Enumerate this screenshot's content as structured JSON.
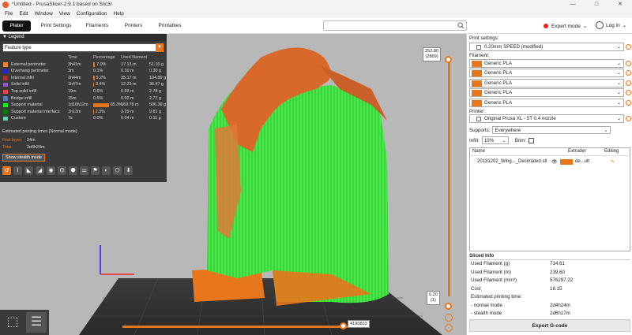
{
  "window": {
    "title": "*Untitled - PrusaSlicer-2.9.1 based on Slic3r",
    "controls": [
      "—",
      "□",
      "✕"
    ]
  },
  "menu": [
    "File",
    "Edit",
    "Window",
    "View",
    "Configuration",
    "Help"
  ],
  "tabs": [
    "Plater",
    "Print Settings",
    "Filaments",
    "Printers",
    "Printables"
  ],
  "search": {
    "placeholder": ""
  },
  "mode": {
    "label": "Expert mode",
    "color": "#e22222"
  },
  "login": {
    "label": "Log in"
  },
  "legend": {
    "header": "Legend",
    "view_type": "Feature type",
    "columns": [
      "Time",
      "Percentage",
      "Used filament"
    ],
    "rows": [
      {
        "name": "External perimeter",
        "time": "3h41m",
        "pct": "7.0%",
        "pct_value": 0.07,
        "length": "17.13 m",
        "weight": "51.10 g",
        "color": "#ff7f2a"
      },
      {
        "name": "Overhang perimeter",
        "time": "3m",
        "pct": "0.1%",
        "pct_value": 0.001,
        "length": "0.10 m",
        "weight": "0.30 g",
        "color": "#1f1fff"
      },
      {
        "name": "Internal infill",
        "time": "2h44m",
        "pct": "5.2%",
        "pct_value": 0.052,
        "length": "35.17 m",
        "weight": "104.89 g",
        "color": "#b03029"
      },
      {
        "name": "Solid infill",
        "time": "1h47m",
        "pct": "3.4%",
        "pct_value": 0.034,
        "length": "12.23 m",
        "weight": "36.47 g",
        "color": "#9654cc"
      },
      {
        "name": "Top solid infill",
        "time": "19m",
        "pct": "0.6%",
        "pct_value": 0.006,
        "length": "0.93 m",
        "weight": "2.78 g",
        "color": "#f04040"
      },
      {
        "name": "Bridge infill",
        "time": "15m",
        "pct": "0.5%",
        "pct_value": 0.005,
        "length": "0.93 m",
        "weight": "2.77 g",
        "color": "#4d80ba"
      },
      {
        "name": "Support material",
        "time": "1d10h12m",
        "pct": "65.3%",
        "pct_value": 0.653,
        "length": "169.78 m",
        "weight": "506.39 g",
        "color": "#00ff00"
      },
      {
        "name": "Support material interface",
        "time": "1h13m",
        "pct": "2.3%",
        "pct_value": 0.023,
        "length": "3.29 m",
        "weight": "9.81 g",
        "color": "#008000"
      },
      {
        "name": "Custom",
        "time": "7s",
        "pct": "0.0%",
        "pct_value": 0.0,
        "length": "0.04 m",
        "weight": "0.11 g",
        "color": "#5ed3b0"
      }
    ],
    "est_title": "Estimated printing times [Normal mode]:",
    "first_layer_label": "First layer:",
    "first_layer_value": "24m",
    "total_label": "Total:",
    "total_value": "2d4h24m",
    "stealth_button": "Show stealth mode"
  },
  "sliders": {
    "vertical_top": "252.80",
    "vertical_top_sub": "(2869)",
    "vertical_bottom": "0.20",
    "vertical_bottom_sub": "(1)",
    "horizontal": "4190833"
  },
  "right_panel": {
    "print_settings_label": "Print settings:",
    "print_profile": "0.20mm SPEED (modified)",
    "filament_label": "Filament:",
    "filaments": [
      "Generic PLA",
      "Generic PLA",
      "Generic PLA",
      "Generic PLA",
      "Generic PLA"
    ],
    "filament_colors": [
      "#e8761c",
      "#e8761c",
      "#e8761c",
      "#e8761c",
      "#e8761c"
    ],
    "printer_label": "Printer:",
    "printer": "Original Prusa XL - 5T 0.4 nozzle",
    "supports_label": "Supports:",
    "supports_value": "Everywhere",
    "infill_label": "Infill:",
    "infill_value": "10%",
    "brim_label": "Brim:",
    "object_columns": [
      "Name",
      "Extruder",
      "Editing"
    ],
    "object_name": "20131202_Wing..._Decimated.stl",
    "object_extruder": "de...ult",
    "sliced_title": "Sliced Info",
    "sliced_rows": [
      {
        "k": "Used Filament (g)",
        "v": "714.61"
      },
      {
        "k": "Used Filament (m)",
        "v": "239.60"
      },
      {
        "k": "Used Filament (mm³)",
        "v": "576297.22"
      },
      {
        "k": "Cost",
        "v": "18.15"
      },
      {
        "k": "Estimated printing time:",
        "v": ""
      },
      {
        "k": " - normal mode",
        "v": "2d4h24m"
      },
      {
        "k": " - stealth mode",
        "v": "2d6h17m"
      }
    ],
    "export_button": "Export G-code"
  }
}
